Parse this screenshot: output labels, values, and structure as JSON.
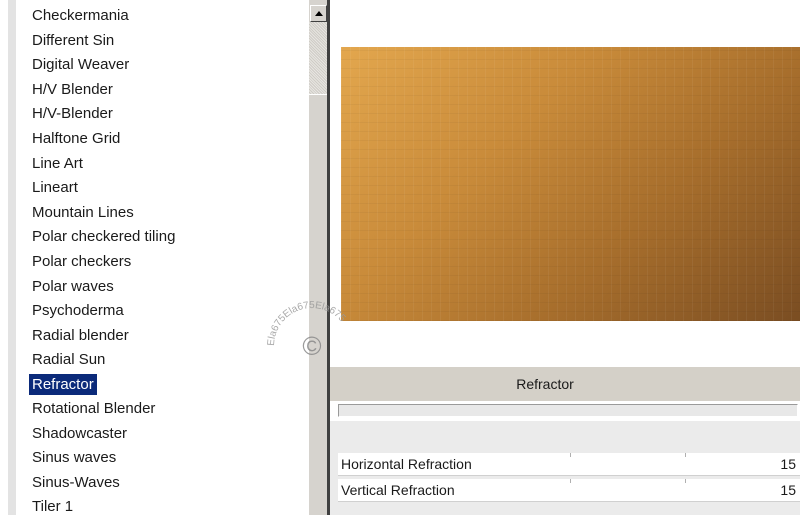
{
  "filters": {
    "items": [
      "Checkermania",
      "Different Sin",
      "Digital Weaver",
      "H/V Blender",
      "H/V-Blender",
      "Halftone Grid",
      "Line Art",
      "Lineart",
      "Mountain Lines",
      "Polar checkered tiling",
      "Polar checkers",
      "Polar waves",
      "Psychoderma",
      "Radial blender",
      "Radial Sun",
      "Refractor",
      "Rotational Blender",
      "Shadowcaster",
      "Sinus waves",
      "Sinus-Waves",
      "Tiler 1"
    ],
    "selected": "Refractor"
  },
  "filter_title": "Refractor",
  "params": {
    "horizontal_label": "Horizontal Refraction",
    "horizontal_value": "15",
    "vertical_label": "Vertical Refraction",
    "vertical_value": "15"
  },
  "watermark": {
    "text": "Ela675Ela675Ela675",
    "symbol": "©"
  },
  "colors": {
    "selection": "#0b2a7a",
    "preview_light": "#e3a74e",
    "preview_dark": "#7a4d22"
  },
  "icons": {
    "scroll_up": "scroll-up-arrow-icon"
  }
}
